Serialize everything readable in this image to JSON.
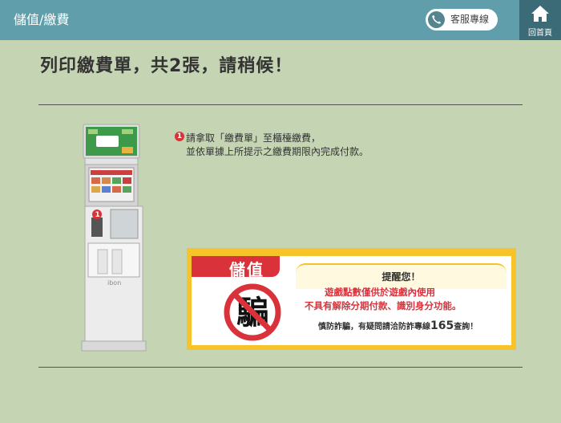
{
  "header": {
    "title": "儲值/繳費",
    "service_label": "客服專線",
    "home_label": "回首頁"
  },
  "main": {
    "title": "列印繳費單，共2張，請稍候！"
  },
  "kiosk": {
    "brand": "ibon",
    "step_marker": "1"
  },
  "instruction": {
    "step": "1",
    "line1": "請拿取「繳費單」至櫃檯繳費，",
    "line2": "並依單據上所提示之繳費期限內完成付款。"
  },
  "banner": {
    "tab_label": "儲值",
    "remind": "提醒您！",
    "scam_char": "騙",
    "line1": "遊戲點數僅供於遊戲內使用",
    "line2": "不具有解除分期付款、識別身分功能。",
    "line3_pre": "慎防詐騙，有疑問請洽防詐專線",
    "line3_num": "165",
    "line3_post": "查詢！"
  },
  "colors": {
    "background": "#c5d5b4",
    "header": "#5f9eaa",
    "home_button": "#3b6b77",
    "warning_red": "#d9323a",
    "warning_yellow": "#f7c32a"
  }
}
